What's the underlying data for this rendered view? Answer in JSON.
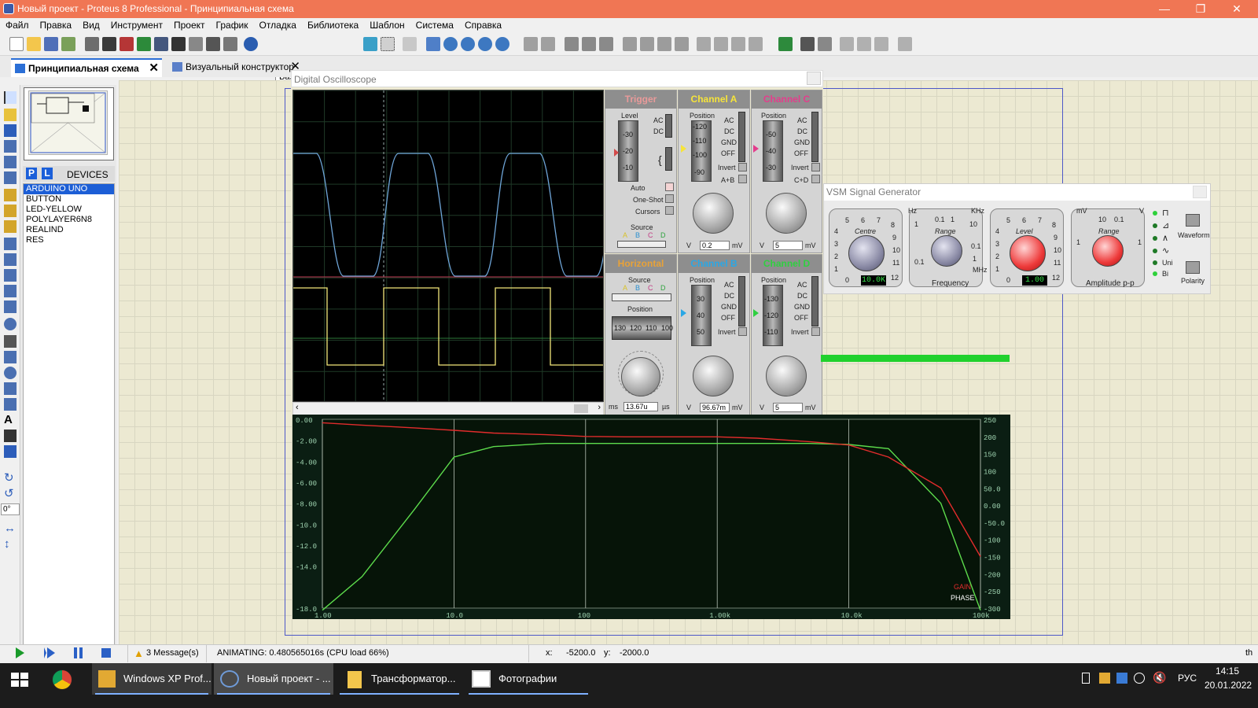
{
  "titlebar": {
    "title": "Новый проект - Proteus 8 Professional - Принципиальная схема",
    "minimize": "—",
    "maximize": "❐",
    "close": "✕"
  },
  "menubar": [
    "Файл",
    "Правка",
    "Вид",
    "Инструмент",
    "Проект",
    "График",
    "Отладка",
    "Библиотека",
    "Шаблон",
    "Система",
    "Справка"
  ],
  "toolbar": {
    "design_select": "Base Design"
  },
  "tabs": [
    {
      "label": "Принципиальная схема",
      "active": true
    },
    {
      "label": "Визуальный конструктор",
      "active": false
    }
  ],
  "tab_close": "✕",
  "sidebar": {
    "p_button": "P",
    "l_button": "L",
    "devices_title": "DEVICES",
    "devices": [
      "ARDUINO UNO",
      "BUTTON",
      "LED-YELLOW",
      "POLYLAYER6N8",
      "REALIND",
      "RES"
    ],
    "rotation_value": "0°"
  },
  "oscilloscope": {
    "title": "Digital Oscilloscope",
    "trigger": {
      "header": "Trigger",
      "level_label": "Level",
      "ac": "AC",
      "dc": "DC",
      "level_ticks": [
        "-30",
        "-20",
        "-10"
      ],
      "auto": "Auto",
      "one_shot": "One-Shot",
      "cursors": "Cursors",
      "source": "Source",
      "source_letters": [
        "A",
        "B",
        "C",
        "D"
      ]
    },
    "horizontal": {
      "header": "Horizontal",
      "source": "Source",
      "source_letters": [
        "A",
        "B",
        "C",
        "D"
      ],
      "position": "Position",
      "position_ticks": [
        "130",
        "120",
        "110",
        "100"
      ],
      "knob_value": "13.67u",
      "unit_left": "ms",
      "unit_right": "µs"
    },
    "channels": [
      {
        "name": "Channel A",
        "color": "#f6e43a",
        "position": "Position",
        "ticks": [
          "-120",
          "-110",
          "-100",
          "-90"
        ],
        "modes": [
          "AC",
          "DC",
          "GND",
          "OFF"
        ],
        "invert": "Invert",
        "combine": "A+B",
        "value": "0.2",
        "unit_left": "V",
        "unit_right": "mV"
      },
      {
        "name": "Channel C",
        "color": "#e43d8c",
        "position": "Position",
        "ticks": [
          "-50",
          "-40",
          "-30"
        ],
        "modes": [
          "AC",
          "DC",
          "GND",
          "OFF"
        ],
        "invert": "Invert",
        "combine": "C+D",
        "value": "5",
        "unit_left": "V",
        "unit_right": "mV"
      },
      {
        "name": "Channel B",
        "color": "#2aa7e5",
        "position": "Position",
        "ticks": [
          "30",
          "40",
          "50"
        ],
        "modes": [
          "AC",
          "DC",
          "GND",
          "OFF"
        ],
        "invert": "Invert",
        "combine": "",
        "value": "96.67m",
        "unit_left": "V",
        "unit_right": "mV"
      },
      {
        "name": "Channel D",
        "color": "#2fd040",
        "position": "Position",
        "ticks": [
          "-130",
          "-120",
          "-110"
        ],
        "modes": [
          "AC",
          "DC",
          "GND",
          "OFF"
        ],
        "invert": "Invert",
        "combine": "",
        "value": "5",
        "unit_left": "V",
        "unit_right": "mV"
      }
    ],
    "trace_colors": {
      "a": "#6fa6d9",
      "b": "#f2e77a",
      "c": "#c13a55"
    }
  },
  "signal_generator": {
    "title": "VSM Signal Generator",
    "centre_label": "Centre",
    "centre_value": "10.0K",
    "centre_ticks": [
      "5",
      "6",
      "7",
      "8",
      "9",
      "10",
      "11",
      "12",
      "0",
      "1",
      "2",
      "3",
      "4"
    ],
    "range_label": "Range",
    "range_ticks": [
      "0.1",
      "1",
      "10",
      "1",
      "0.1",
      "0.1",
      "1"
    ],
    "hz": "Hz",
    "khz": "KHz",
    "mhz": "MHz",
    "frequency_label": "Frequency",
    "level_label": "Level",
    "level_value": "1.00",
    "level_ticks": [
      "5",
      "6",
      "7",
      "8",
      "9",
      "10",
      "11",
      "12",
      "0",
      "1",
      "2",
      "3",
      "4"
    ],
    "amp_range_label": "Range",
    "amp_range_ticks": [
      "10",
      "0.1",
      "1",
      "1"
    ],
    "mv": "mV",
    "v": "V",
    "amplitude_label": "Amplitude p-p",
    "waveform_label": "Waveform",
    "uni": "Uni",
    "bi": "Bi",
    "polarity_label": "Polarity"
  },
  "graph": {
    "y_left_ticks": [
      "0.00",
      "-2.00",
      "-4.00",
      "-6.00",
      "-8.00",
      "-10.0",
      "-12.0",
      "-14.0",
      "-18.0"
    ],
    "y_right_ticks": [
      "250",
      "200",
      "150",
      "100",
      "50.0",
      "0.00",
      "-50.0",
      "-100",
      "-150",
      "-200",
      "-250",
      "-300"
    ],
    "x_ticks": [
      "1.00",
      "10.0",
      "100",
      "1.00k",
      "10.0k",
      "100k"
    ],
    "gain_label": "GAIN",
    "phase_label": "PHASE",
    "gain_color": "#5ddc4c",
    "phase_color": "#e22c2c",
    "chart_data": {
      "type": "line",
      "x_scale": "log",
      "x": [
        1,
        2,
        5,
        10,
        20,
        50,
        100,
        200,
        500,
        1000,
        2000,
        5000,
        10000,
        20000,
        50000,
        100000
      ],
      "series": [
        {
          "name": "GAIN",
          "axis": "left",
          "values": [
            -18.2,
            -15.0,
            -8.6,
            -3.6,
            -2.6,
            -2.3,
            -2.3,
            -2.3,
            -2.3,
            -2.3,
            -2.3,
            -2.3,
            -2.4,
            -2.8,
            -8.0,
            -18.2
          ]
        },
        {
          "name": "PHASE",
          "axis": "right",
          "values": [
            240,
            233,
            225,
            218,
            210,
            205,
            200,
            199,
            199,
            199,
            195,
            185,
            175,
            140,
            50,
            -150
          ]
        }
      ],
      "ylim_left": [
        -18,
        0
      ],
      "ylim_right": [
        -300,
        250
      ],
      "xlim": [
        1,
        100000
      ]
    }
  },
  "status": {
    "messages": "3 Message(s)",
    "animating": "ANIMATING: 0.480565016s (CPU load 66%)",
    "x_label": "x:",
    "x_value": "-5200.0",
    "y_label": "y:",
    "y_value": "-2000.0",
    "unit": "th"
  },
  "taskbar": {
    "apps": [
      "Windows XP Prof...",
      "Новый проект - ...",
      "Трансформатор...",
      "Фотографии"
    ],
    "lang": "РУС",
    "time": "14:15",
    "date": "20.01.2022"
  }
}
